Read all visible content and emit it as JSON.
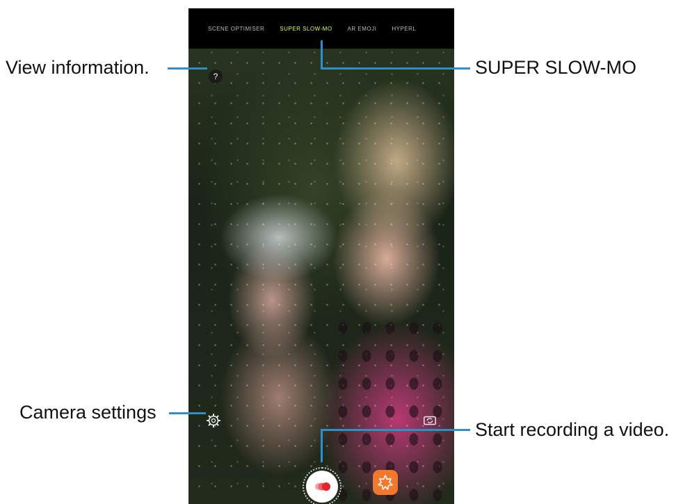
{
  "camera": {
    "modes": [
      "SCENE OPTIMISER",
      "SUPER SLOW-MO",
      "AR EMOJI",
      "HYPERL"
    ],
    "active_mode": "SUPER SLOW-MO",
    "info_icon": "?"
  },
  "callouts": {
    "view_information": "View information.",
    "super_slow_mo": "SUPER SLOW-MO",
    "camera_settings": "Camera settings",
    "start_recording": "Start recording a video."
  },
  "icons": {
    "info": "question-icon",
    "settings": "gear-icon",
    "switch_camera": "switch-camera-icon",
    "record": "record-icon",
    "effects": "effects-icon"
  },
  "colors": {
    "callout_line": "#2e8fc9",
    "active_mode": "#d7ff5a",
    "record_red": "#e0252a",
    "effects_orange": "#f2782b"
  }
}
